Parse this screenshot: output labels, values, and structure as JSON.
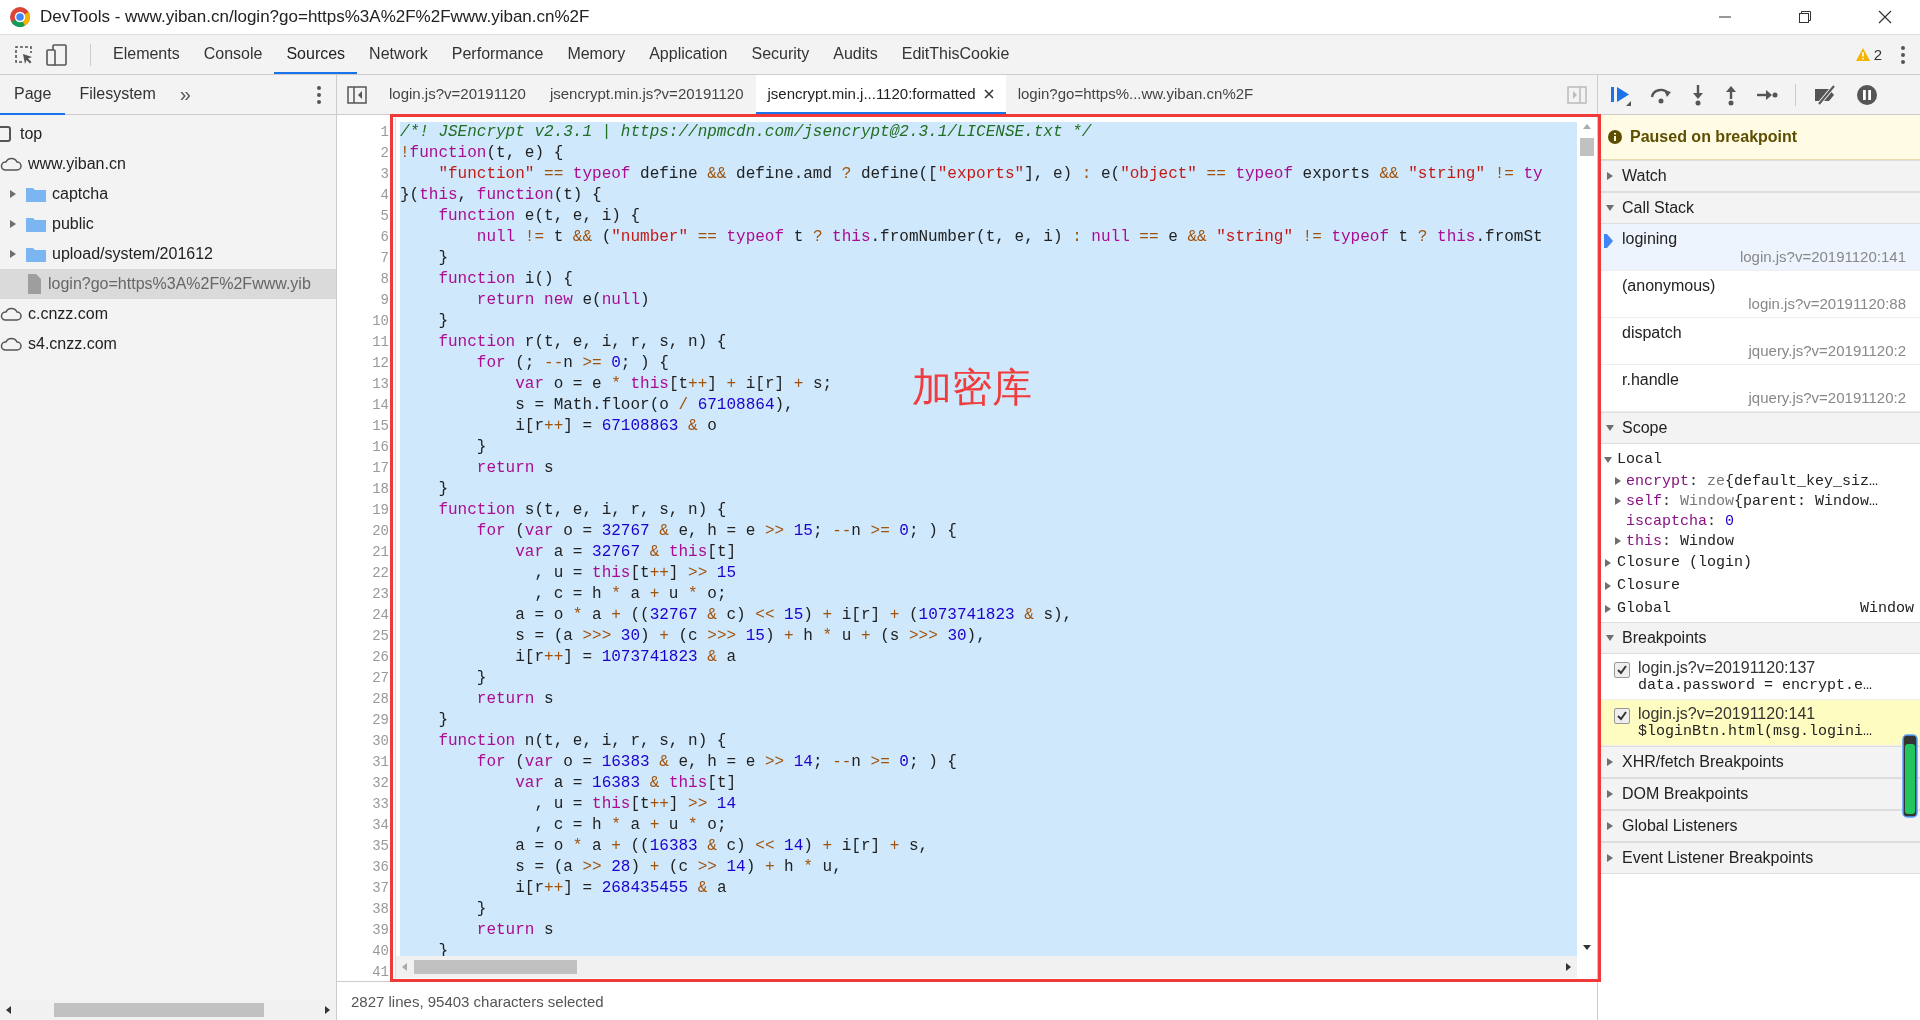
{
  "window": {
    "title": "DevTools - www.yiban.cn/login?go=https%3A%2F%2Fwww.yiban.cn%2F"
  },
  "panel_tabs": [
    {
      "label": "Elements",
      "selected": false
    },
    {
      "label": "Console",
      "selected": false
    },
    {
      "label": "Sources",
      "selected": true
    },
    {
      "label": "Network",
      "selected": false
    },
    {
      "label": "Performance",
      "selected": false
    },
    {
      "label": "Memory",
      "selected": false
    },
    {
      "label": "Application",
      "selected": false
    },
    {
      "label": "Security",
      "selected": false
    },
    {
      "label": "Audits",
      "selected": false
    },
    {
      "label": "EditThisCookie",
      "selected": false
    }
  ],
  "warnings": "2",
  "navigator": {
    "tabs": [
      {
        "label": "Page",
        "selected": true
      },
      {
        "label": "Filesystem",
        "selected": false
      }
    ],
    "more": "»",
    "tree": [
      {
        "label": "top",
        "kind": "frame",
        "selected": false
      },
      {
        "label": "www.yiban.cn",
        "kind": "domain",
        "selected": false,
        "children": [
          {
            "label": "captcha",
            "kind": "folder",
            "expanded": false,
            "selected": false
          },
          {
            "label": "public",
            "kind": "folder",
            "expanded": false,
            "selected": false
          },
          {
            "label": "upload/system/201612",
            "kind": "folder",
            "expanded": false,
            "selected": false
          },
          {
            "label": "login?go=https%3A%2F%2Fwww.yib",
            "kind": "file",
            "selected": true
          }
        ]
      },
      {
        "label": "c.cnzz.com",
        "kind": "domain",
        "selected": false
      },
      {
        "label": "s4.cnzz.com",
        "kind": "domain",
        "selected": false
      }
    ]
  },
  "editor": {
    "tabs": [
      {
        "label": "login.js?v=20191120",
        "selected": false,
        "closable": false
      },
      {
        "label": "jsencrypt.min.js?v=20191120",
        "selected": false,
        "closable": false
      },
      {
        "label": "jsencrypt.min.j...1120:formatted",
        "selected": true,
        "closable": true
      },
      {
        "label": "login?go=https%...ww.yiban.cn%2F",
        "selected": false,
        "closable": false
      }
    ],
    "lines": [
      {
        "number": "1",
        "tokens": [
          {
            "kind": "comment",
            "text": "/*! JSEncrypt v2.3.1 | https://npmcdn.com/jsencrypt@2.3.1/LICENSE.txt */"
          }
        ]
      },
      {
        "number": "2",
        "tokens": [
          {
            "kind": "operator",
            "text": "!"
          },
          {
            "kind": "keyword",
            "text": "function"
          },
          {
            "kind": "plain",
            "text": "(t, e) {"
          }
        ]
      },
      {
        "number": "3",
        "tokens": [
          {
            "kind": "string",
            "text": "    \"function\""
          },
          {
            "kind": "operator",
            "text": " == "
          },
          {
            "kind": "keyword",
            "text": "typeof"
          },
          {
            "kind": "plain",
            "text": " define "
          },
          {
            "kind": "operator",
            "text": "&&"
          },
          {
            "kind": "plain",
            "text": " define.amd "
          },
          {
            "kind": "operator",
            "text": "?"
          },
          {
            "kind": "plain",
            "text": " define(["
          },
          {
            "kind": "string",
            "text": "\"exports\""
          },
          {
            "kind": "plain",
            "text": "], e) "
          },
          {
            "kind": "operator",
            "text": ":"
          },
          {
            "kind": "plain",
            "text": " e("
          },
          {
            "kind": "string",
            "text": "\"object\""
          },
          {
            "kind": "operator",
            "text": " == "
          },
          {
            "kind": "keyword",
            "text": "typeof"
          },
          {
            "kind": "plain",
            "text": " exports "
          },
          {
            "kind": "operator",
            "text": "&&"
          },
          {
            "kind": "string",
            "text": " \"string\""
          },
          {
            "kind": "operator",
            "text": " != "
          },
          {
            "kind": "keyword",
            "text": "ty"
          }
        ]
      },
      {
        "number": "4",
        "tokens": [
          {
            "kind": "plain",
            "text": "}("
          },
          {
            "kind": "keyword",
            "text": "this"
          },
          {
            "kind": "plain",
            "text": ", "
          },
          {
            "kind": "keyword",
            "text": "function"
          },
          {
            "kind": "plain",
            "text": "(t) {"
          }
        ]
      },
      {
        "number": "5",
        "tokens": [
          {
            "kind": "keyword",
            "text": "    function"
          },
          {
            "kind": "plain",
            "text": " e(t, e, i) {"
          }
        ]
      },
      {
        "number": "6",
        "tokens": [
          {
            "kind": "keyword",
            "text": "        null"
          },
          {
            "kind": "operator",
            "text": " != "
          },
          {
            "kind": "plain",
            "text": "t "
          },
          {
            "kind": "operator",
            "text": "&&"
          },
          {
            "kind": "plain",
            "text": " ("
          },
          {
            "kind": "string",
            "text": "\"number\""
          },
          {
            "kind": "operator",
            "text": " == "
          },
          {
            "kind": "keyword",
            "text": "typeof"
          },
          {
            "kind": "plain",
            "text": " t "
          },
          {
            "kind": "operator",
            "text": "?"
          },
          {
            "kind": "keyword",
            "text": " this"
          },
          {
            "kind": "plain",
            "text": ".fromNumber(t, e, i) "
          },
          {
            "kind": "operator",
            "text": ":"
          },
          {
            "kind": "keyword",
            "text": " null"
          },
          {
            "kind": "operator",
            "text": " == "
          },
          {
            "kind": "plain",
            "text": "e "
          },
          {
            "kind": "operator",
            "text": "&&"
          },
          {
            "kind": "string",
            "text": " \"string\""
          },
          {
            "kind": "operator",
            "text": " != "
          },
          {
            "kind": "keyword",
            "text": "typeof"
          },
          {
            "kind": "plain",
            "text": " t "
          },
          {
            "kind": "operator",
            "text": "?"
          },
          {
            "kind": "keyword",
            "text": " this"
          },
          {
            "kind": "plain",
            "text": ".fromSt"
          }
        ]
      },
      {
        "number": "7",
        "tokens": [
          {
            "kind": "plain",
            "text": "    }"
          }
        ]
      },
      {
        "number": "8",
        "tokens": [
          {
            "kind": "keyword",
            "text": "    function"
          },
          {
            "kind": "plain",
            "text": " i() {"
          }
        ]
      },
      {
        "number": "9",
        "tokens": [
          {
            "kind": "keyword",
            "text": "        return new"
          },
          {
            "kind": "plain",
            "text": " e("
          },
          {
            "kind": "keyword",
            "text": "null"
          },
          {
            "kind": "plain",
            "text": ")"
          }
        ]
      },
      {
        "number": "10",
        "tokens": [
          {
            "kind": "plain",
            "text": "    }"
          }
        ]
      },
      {
        "number": "11",
        "tokens": [
          {
            "kind": "keyword",
            "text": "    function"
          },
          {
            "kind": "plain",
            "text": " r(t, e, i, r, s, n) {"
          }
        ]
      },
      {
        "number": "12",
        "tokens": [
          {
            "kind": "keyword",
            "text": "        for"
          },
          {
            "kind": "plain",
            "text": " (; "
          },
          {
            "kind": "operator",
            "text": "--"
          },
          {
            "kind": "plain",
            "text": "n "
          },
          {
            "kind": "operator",
            "text": ">="
          },
          {
            "kind": "number",
            "text": " 0"
          },
          {
            "kind": "plain",
            "text": "; ) {"
          }
        ]
      },
      {
        "number": "13",
        "tokens": [
          {
            "kind": "keyword",
            "text": "            var"
          },
          {
            "kind": "plain",
            "text": " o = e "
          },
          {
            "kind": "operator",
            "text": "*"
          },
          {
            "kind": "keyword",
            "text": " this"
          },
          {
            "kind": "plain",
            "text": "[t"
          },
          {
            "kind": "operator",
            "text": "++"
          },
          {
            "kind": "plain",
            "text": "] "
          },
          {
            "kind": "operator",
            "text": "+"
          },
          {
            "kind": "plain",
            "text": " i[r] "
          },
          {
            "kind": "operator",
            "text": "+"
          },
          {
            "kind": "plain",
            "text": " s;"
          }
        ]
      },
      {
        "number": "14",
        "tokens": [
          {
            "kind": "plain",
            "text": "            s = Math.floor(o "
          },
          {
            "kind": "operator",
            "text": "/"
          },
          {
            "kind": "number",
            "text": " 67108864"
          },
          {
            "kind": "plain",
            "text": "),"
          }
        ]
      },
      {
        "number": "15",
        "tokens": [
          {
            "kind": "plain",
            "text": "            i[r"
          },
          {
            "kind": "operator",
            "text": "++"
          },
          {
            "kind": "plain",
            "text": "] = "
          },
          {
            "kind": "number",
            "text": "67108863"
          },
          {
            "kind": "operator",
            "text": " & "
          },
          {
            "kind": "plain",
            "text": "o"
          }
        ]
      },
      {
        "number": "16",
        "tokens": [
          {
            "kind": "plain",
            "text": "        }"
          }
        ]
      },
      {
        "number": "17",
        "tokens": [
          {
            "kind": "keyword",
            "text": "        return"
          },
          {
            "kind": "plain",
            "text": " s"
          }
        ]
      },
      {
        "number": "18",
        "tokens": [
          {
            "kind": "plain",
            "text": "    }"
          }
        ]
      },
      {
        "number": "19",
        "tokens": [
          {
            "kind": "keyword",
            "text": "    function"
          },
          {
            "kind": "plain",
            "text": " s(t, e, i, r, s, n) {"
          }
        ]
      },
      {
        "number": "20",
        "tokens": [
          {
            "kind": "keyword",
            "text": "        for"
          },
          {
            "kind": "plain",
            "text": " ("
          },
          {
            "kind": "keyword",
            "text": "var"
          },
          {
            "kind": "plain",
            "text": " o = "
          },
          {
            "kind": "number",
            "text": "32767"
          },
          {
            "kind": "operator",
            "text": " & "
          },
          {
            "kind": "plain",
            "text": "e, h = e "
          },
          {
            "kind": "operator",
            "text": ">>"
          },
          {
            "kind": "number",
            "text": " 15"
          },
          {
            "kind": "plain",
            "text": "; "
          },
          {
            "kind": "operator",
            "text": "--"
          },
          {
            "kind": "plain",
            "text": "n "
          },
          {
            "kind": "operator",
            "text": ">="
          },
          {
            "kind": "number",
            "text": " 0"
          },
          {
            "kind": "plain",
            "text": "; ) {"
          }
        ]
      },
      {
        "number": "21",
        "tokens": [
          {
            "kind": "keyword",
            "text": "            var"
          },
          {
            "kind": "plain",
            "text": " a = "
          },
          {
            "kind": "number",
            "text": "32767"
          },
          {
            "kind": "operator",
            "text": " & "
          },
          {
            "kind": "keyword",
            "text": "this"
          },
          {
            "kind": "plain",
            "text": "[t]"
          }
        ]
      },
      {
        "number": "22",
        "tokens": [
          {
            "kind": "plain",
            "text": "              , u = "
          },
          {
            "kind": "keyword",
            "text": "this"
          },
          {
            "kind": "plain",
            "text": "[t"
          },
          {
            "kind": "operator",
            "text": "++"
          },
          {
            "kind": "plain",
            "text": "] "
          },
          {
            "kind": "operator",
            "text": ">>"
          },
          {
            "kind": "number",
            "text": " 15"
          }
        ]
      },
      {
        "number": "23",
        "tokens": [
          {
            "kind": "plain",
            "text": "              , c = h "
          },
          {
            "kind": "operator",
            "text": "*"
          },
          {
            "kind": "plain",
            "text": " a "
          },
          {
            "kind": "operator",
            "text": "+"
          },
          {
            "kind": "plain",
            "text": " u "
          },
          {
            "kind": "operator",
            "text": "*"
          },
          {
            "kind": "plain",
            "text": " o;"
          }
        ]
      },
      {
        "number": "24",
        "tokens": [
          {
            "kind": "plain",
            "text": "            a = o "
          },
          {
            "kind": "operator",
            "text": "*"
          },
          {
            "kind": "plain",
            "text": " a "
          },
          {
            "kind": "operator",
            "text": "+"
          },
          {
            "kind": "plain",
            "text": " (("
          },
          {
            "kind": "number",
            "text": "32767"
          },
          {
            "kind": "operator",
            "text": " & "
          },
          {
            "kind": "plain",
            "text": "c) "
          },
          {
            "kind": "operator",
            "text": "<<"
          },
          {
            "kind": "number",
            "text": " 15"
          },
          {
            "kind": "plain",
            "text": ") "
          },
          {
            "kind": "operator",
            "text": "+"
          },
          {
            "kind": "plain",
            "text": " i[r] "
          },
          {
            "kind": "operator",
            "text": "+"
          },
          {
            "kind": "plain",
            "text": " ("
          },
          {
            "kind": "number",
            "text": "1073741823"
          },
          {
            "kind": "operator",
            "text": " & "
          },
          {
            "kind": "plain",
            "text": "s),"
          }
        ]
      },
      {
        "number": "25",
        "tokens": [
          {
            "kind": "plain",
            "text": "            s = (a "
          },
          {
            "kind": "operator",
            "text": ">>>"
          },
          {
            "kind": "number",
            "text": " 30"
          },
          {
            "kind": "plain",
            "text": ") "
          },
          {
            "kind": "operator",
            "text": "+"
          },
          {
            "kind": "plain",
            "text": " (c "
          },
          {
            "kind": "operator",
            "text": ">>>"
          },
          {
            "kind": "number",
            "text": " 15"
          },
          {
            "kind": "plain",
            "text": ") "
          },
          {
            "kind": "operator",
            "text": "+"
          },
          {
            "kind": "plain",
            "text": " h "
          },
          {
            "kind": "operator",
            "text": "*"
          },
          {
            "kind": "plain",
            "text": " u "
          },
          {
            "kind": "operator",
            "text": "+"
          },
          {
            "kind": "plain",
            "text": " (s "
          },
          {
            "kind": "operator",
            "text": ">>>"
          },
          {
            "kind": "number",
            "text": " 30"
          },
          {
            "kind": "plain",
            "text": "),"
          }
        ]
      },
      {
        "number": "26",
        "tokens": [
          {
            "kind": "plain",
            "text": "            i[r"
          },
          {
            "kind": "operator",
            "text": "++"
          },
          {
            "kind": "plain",
            "text": "] = "
          },
          {
            "kind": "number",
            "text": "1073741823"
          },
          {
            "kind": "operator",
            "text": " & "
          },
          {
            "kind": "plain",
            "text": "a"
          }
        ]
      },
      {
        "number": "27",
        "tokens": [
          {
            "kind": "plain",
            "text": "        }"
          }
        ]
      },
      {
        "number": "28",
        "tokens": [
          {
            "kind": "keyword",
            "text": "        return"
          },
          {
            "kind": "plain",
            "text": " s"
          }
        ]
      },
      {
        "number": "29",
        "tokens": [
          {
            "kind": "plain",
            "text": "    }"
          }
        ]
      },
      {
        "number": "30",
        "tokens": [
          {
            "kind": "keyword",
            "text": "    function"
          },
          {
            "kind": "plain",
            "text": " n(t, e, i, r, s, n) {"
          }
        ]
      },
      {
        "number": "31",
        "tokens": [
          {
            "kind": "keyword",
            "text": "        for"
          },
          {
            "kind": "plain",
            "text": " ("
          },
          {
            "kind": "keyword",
            "text": "var"
          },
          {
            "kind": "plain",
            "text": " o = "
          },
          {
            "kind": "number",
            "text": "16383"
          },
          {
            "kind": "operator",
            "text": " & "
          },
          {
            "kind": "plain",
            "text": "e, h = e "
          },
          {
            "kind": "operator",
            "text": ">>"
          },
          {
            "kind": "number",
            "text": " 14"
          },
          {
            "kind": "plain",
            "text": "; "
          },
          {
            "kind": "operator",
            "text": "--"
          },
          {
            "kind": "plain",
            "text": "n "
          },
          {
            "kind": "operator",
            "text": ">="
          },
          {
            "kind": "number",
            "text": " 0"
          },
          {
            "kind": "plain",
            "text": "; ) {"
          }
        ]
      },
      {
        "number": "32",
        "tokens": [
          {
            "kind": "keyword",
            "text": "            var"
          },
          {
            "kind": "plain",
            "text": " a = "
          },
          {
            "kind": "number",
            "text": "16383"
          },
          {
            "kind": "operator",
            "text": " & "
          },
          {
            "kind": "keyword",
            "text": "this"
          },
          {
            "kind": "plain",
            "text": "[t]"
          }
        ]
      },
      {
        "number": "33",
        "tokens": [
          {
            "kind": "plain",
            "text": "              , u = "
          },
          {
            "kind": "keyword",
            "text": "this"
          },
          {
            "kind": "plain",
            "text": "[t"
          },
          {
            "kind": "operator",
            "text": "++"
          },
          {
            "kind": "plain",
            "text": "] "
          },
          {
            "kind": "operator",
            "text": ">>"
          },
          {
            "kind": "number",
            "text": " 14"
          }
        ]
      },
      {
        "number": "34",
        "tokens": [
          {
            "kind": "plain",
            "text": "              , c = h "
          },
          {
            "kind": "operator",
            "text": "*"
          },
          {
            "kind": "plain",
            "text": " a "
          },
          {
            "kind": "operator",
            "text": "+"
          },
          {
            "kind": "plain",
            "text": " u "
          },
          {
            "kind": "operator",
            "text": "*"
          },
          {
            "kind": "plain",
            "text": " o;"
          }
        ]
      },
      {
        "number": "35",
        "tokens": [
          {
            "kind": "plain",
            "text": "            a = o "
          },
          {
            "kind": "operator",
            "text": "*"
          },
          {
            "kind": "plain",
            "text": " a "
          },
          {
            "kind": "operator",
            "text": "+"
          },
          {
            "kind": "plain",
            "text": " (("
          },
          {
            "kind": "number",
            "text": "16383"
          },
          {
            "kind": "operator",
            "text": " & "
          },
          {
            "kind": "plain",
            "text": "c) "
          },
          {
            "kind": "operator",
            "text": "<<"
          },
          {
            "kind": "number",
            "text": " 14"
          },
          {
            "kind": "plain",
            "text": ") "
          },
          {
            "kind": "operator",
            "text": "+"
          },
          {
            "kind": "plain",
            "text": " i[r] "
          },
          {
            "kind": "operator",
            "text": "+"
          },
          {
            "kind": "plain",
            "text": " s,"
          }
        ]
      },
      {
        "number": "36",
        "tokens": [
          {
            "kind": "plain",
            "text": "            s = (a "
          },
          {
            "kind": "operator",
            "text": ">>"
          },
          {
            "kind": "number",
            "text": " 28"
          },
          {
            "kind": "plain",
            "text": ") "
          },
          {
            "kind": "operator",
            "text": "+"
          },
          {
            "kind": "plain",
            "text": " (c "
          },
          {
            "kind": "operator",
            "text": ">>"
          },
          {
            "kind": "number",
            "text": " 14"
          },
          {
            "kind": "plain",
            "text": ") "
          },
          {
            "kind": "operator",
            "text": "+"
          },
          {
            "kind": "plain",
            "text": " h "
          },
          {
            "kind": "operator",
            "text": "*"
          },
          {
            "kind": "plain",
            "text": " u,"
          }
        ]
      },
      {
        "number": "37",
        "tokens": [
          {
            "kind": "plain",
            "text": "            i[r"
          },
          {
            "kind": "operator",
            "text": "++"
          },
          {
            "kind": "plain",
            "text": "] = "
          },
          {
            "kind": "number",
            "text": "268435455"
          },
          {
            "kind": "operator",
            "text": " & "
          },
          {
            "kind": "plain",
            "text": "a"
          }
        ]
      },
      {
        "number": "38",
        "tokens": [
          {
            "kind": "plain",
            "text": "        }"
          }
        ]
      },
      {
        "number": "39",
        "tokens": [
          {
            "kind": "keyword",
            "text": "        return"
          },
          {
            "kind": "plain",
            "text": " s"
          }
        ]
      },
      {
        "number": "40",
        "tokens": [
          {
            "kind": "plain",
            "text": "    }"
          }
        ]
      },
      {
        "number": "41"
      }
    ],
    "status": "2827 lines, 95403 characters selected"
  },
  "debugger": {
    "paused": "Paused on breakpoint",
    "sections": [
      {
        "title": "Watch",
        "expanded": false
      },
      {
        "kind": "call_stack",
        "title": "Call Stack",
        "expanded": true,
        "frames": [
          {
            "name": "logining",
            "location": "login.js?v=20191120:141",
            "selected": true
          },
          {
            "name": "(anonymous)",
            "location": "login.js?v=20191120:88",
            "selected": false
          },
          {
            "name": "dispatch",
            "location": "jquery.js?v=20191120:2",
            "selected": false
          },
          {
            "name": "r.handle",
            "location": "jquery.js?v=20191120:2",
            "selected": false
          }
        ]
      },
      {
        "kind": "scope",
        "title": "Scope",
        "expanded": true,
        "scopes": [
          {
            "label": "Local",
            "expanded": true,
            "properties": [
              {
                "name": "encrypt",
                "separator": ":",
                "class": "ze",
                "value": "{default_key_siz…",
                "kind": "object",
                "expandable": true
              },
              {
                "name": "self",
                "separator": ":",
                "class": "Window",
                "value": "{parent: Window…",
                "kind": "object",
                "expandable": true
              },
              {
                "name": "iscaptcha",
                "separator": ":",
                "value": "0",
                "kind": "number",
                "expandable": false
              },
              {
                "name": "this",
                "separator": ":",
                "value": "Window",
                "kind": "object",
                "expandable": true
              }
            ]
          },
          {
            "label": "Closure (login)",
            "expanded": false
          },
          {
            "label": "Closure",
            "expanded": false
          },
          {
            "label": "Global",
            "expanded": false,
            "value": "Window"
          }
        ]
      },
      {
        "kind": "breakpoints",
        "title": "Breakpoints",
        "expanded": true,
        "items": [
          {
            "location": "login.js?v=20191120:137",
            "code": "data.password = encrypt.e…",
            "checked": true,
            "active": false
          },
          {
            "location": "login.js?v=20191120:141",
            "code": "$loginBtn.html(msg.logini…",
            "checked": true,
            "active": true
          }
        ]
      },
      {
        "title": "XHR/fetch Breakpoints",
        "expanded": false
      },
      {
        "title": "DOM Breakpoints",
        "expanded": false
      },
      {
        "title": "Global Listeners",
        "expanded": false
      },
      {
        "title": "Event Listener Breakpoints",
        "expanded": false
      }
    ]
  },
  "annotation": {
    "label": "加密库"
  }
}
